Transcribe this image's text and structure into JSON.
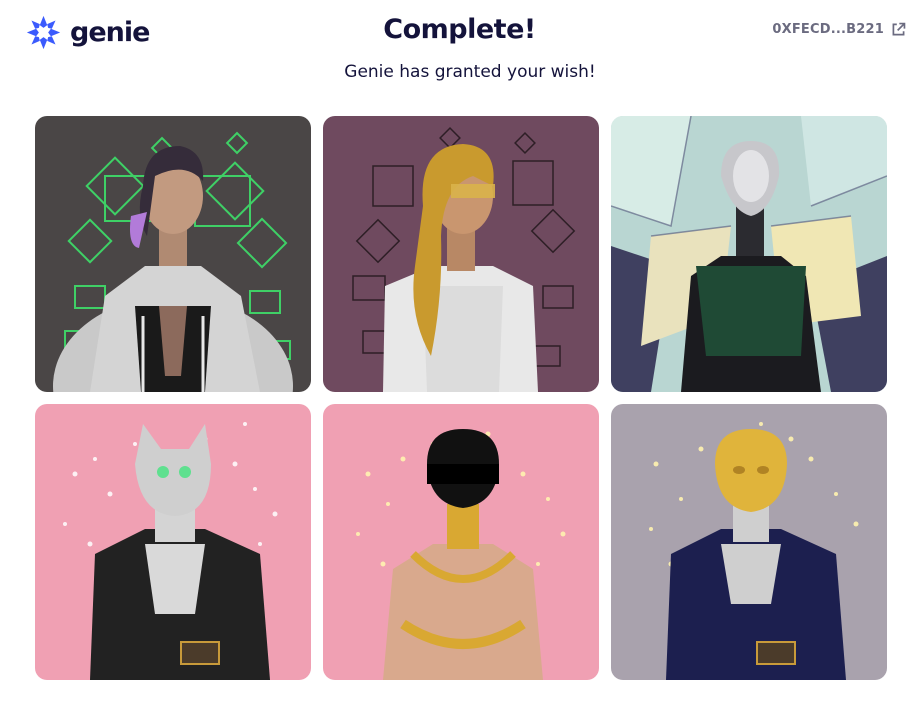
{
  "header": {
    "logo_text": "genie",
    "title": "Complete!",
    "subtitle": "Genie has granted your wish!",
    "wallet_address": "0XFECD...B221",
    "wallet_icon": "external-link-icon",
    "logo_icon": "genie-star-icon"
  },
  "colors": {
    "brand": "#3b5bfd",
    "text": "#14133b",
    "muted": "#6b6b80"
  },
  "gallery": {
    "items": [
      {
        "name": "nft-avatar-green-neon",
        "background": "#4a4646"
      },
      {
        "name": "nft-avatar-gold-hair",
        "background": "#6f4a5f"
      },
      {
        "name": "nft-avatar-silver-robot",
        "background": "#b9d6d2"
      },
      {
        "name": "nft-avatar-cat-mask",
        "background": "#f0a0b3"
      },
      {
        "name": "nft-avatar-black-helmet",
        "background": "#f0a0b3"
      },
      {
        "name": "nft-avatar-gold-mask",
        "background": "#a9a2ad"
      }
    ]
  }
}
